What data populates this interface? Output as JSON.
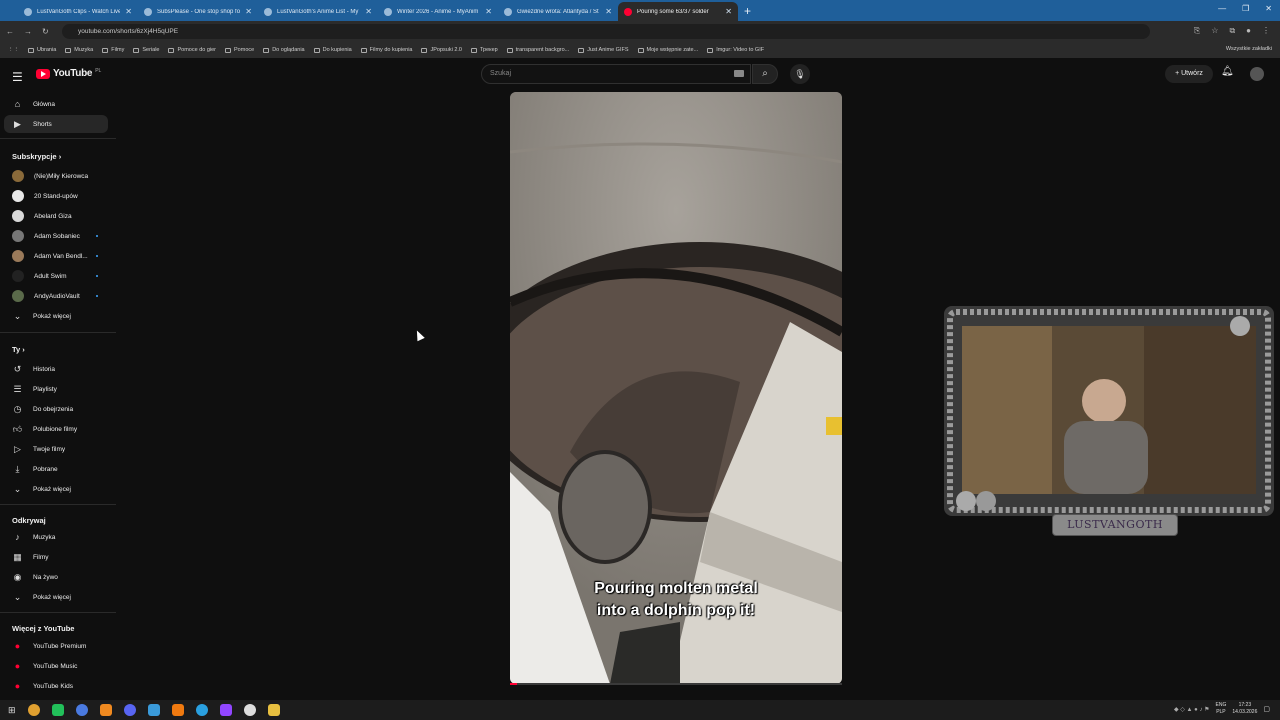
{
  "browser": {
    "tabs": [
      {
        "title": "LustVanGoth Clips - Watch Live",
        "active": false
      },
      {
        "title": "SubsPlease - One stop shop fo",
        "active": false
      },
      {
        "title": "LustVanGoth's Anime List - My",
        "active": false
      },
      {
        "title": "Winter 2026 - Anime - MyAnim",
        "active": false
      },
      {
        "title": "Gwiezdne wrota: Atlantyda / St",
        "active": false
      },
      {
        "title": "Pouring some 63/37 solder",
        "active": true
      }
    ],
    "new_tab": "+",
    "url": "youtube.com/shorts/6zXj4H5qUPE",
    "bookmarks": [
      "Ubrania",
      "Muzyka",
      "Filmy",
      "Seriale",
      "Pomoce do gier",
      "Pomoce",
      "Do oglądania",
      "Do kupienia",
      "Filmy do kupienia",
      "JPopsuki 2.0",
      "Трекер",
      "transparent backgro...",
      "Just Anime GIFS",
      "Moje wstępnie zate...",
      "Imgur: Video to GIF"
    ],
    "bookmarks_all": "Wszystkie zakładki"
  },
  "youtube": {
    "logo_text": "YouTube",
    "country": "PL",
    "search_placeholder": "Szukaj",
    "create_label": "+ Utwórz"
  },
  "sidebar": {
    "main": [
      {
        "label": "Główna",
        "icon": "home-icon",
        "active": false
      },
      {
        "label": "Shorts",
        "icon": "shorts-icon",
        "active": true
      }
    ],
    "subs_header": "Subskrypcje  ›",
    "subs": [
      {
        "label": "(Nie)Miły Kierowca",
        "color": "#8a6a3a",
        "dot": false
      },
      {
        "label": "20 Stand-upów",
        "color": "#e8e8e8",
        "dot": false
      },
      {
        "label": "Abelard Giza",
        "color": "#d8d8d8",
        "dot": false
      },
      {
        "label": "Adam Sobaniec",
        "color": "#777777",
        "dot": true
      },
      {
        "label": "Adam Van Bendl...",
        "color": "#9a7a5a",
        "dot": true
      },
      {
        "label": "Adult Swim",
        "color": "#222222",
        "dot": true
      },
      {
        "label": "AndyAudioVault",
        "color": "#5a6a4a",
        "dot": true
      }
    ],
    "subs_more": "Pokaż więcej",
    "you_header": "Ty  ›",
    "you": [
      {
        "label": "Historia",
        "icon": "history-icon"
      },
      {
        "label": "Playlisty",
        "icon": "playlists-icon"
      },
      {
        "label": "Do obejrzenia",
        "icon": "watch-later-icon"
      },
      {
        "label": "Polubione filmy",
        "icon": "liked-icon"
      },
      {
        "label": "Twoje filmy",
        "icon": "your-videos-icon"
      },
      {
        "label": "Pobrane",
        "icon": "download-icon"
      }
    ],
    "you_more": "Pokaż więcej",
    "explore_header": "Odkrywaj",
    "explore": [
      {
        "label": "Muzyka",
        "icon": "music-icon"
      },
      {
        "label": "Filmy",
        "icon": "movies-icon"
      },
      {
        "label": "Na żywo",
        "icon": "live-icon"
      }
    ],
    "explore_more": "Pokaż więcej",
    "more_header": "Więcej z YouTube",
    "more": [
      {
        "label": "YouTube Premium"
      },
      {
        "label": "YouTube Music"
      },
      {
        "label": "YouTube Kids"
      }
    ]
  },
  "short": {
    "caption_line1": "Pouring molten metal",
    "caption_line2": "into a dolphin pop it!",
    "progress": 0.02
  },
  "stream_overlay": {
    "label": "LUSTVANGOTH"
  },
  "taskbar": {
    "lang1": "ENG",
    "lang2": "PLP",
    "time": "17:23",
    "date": "14.03.2026"
  }
}
